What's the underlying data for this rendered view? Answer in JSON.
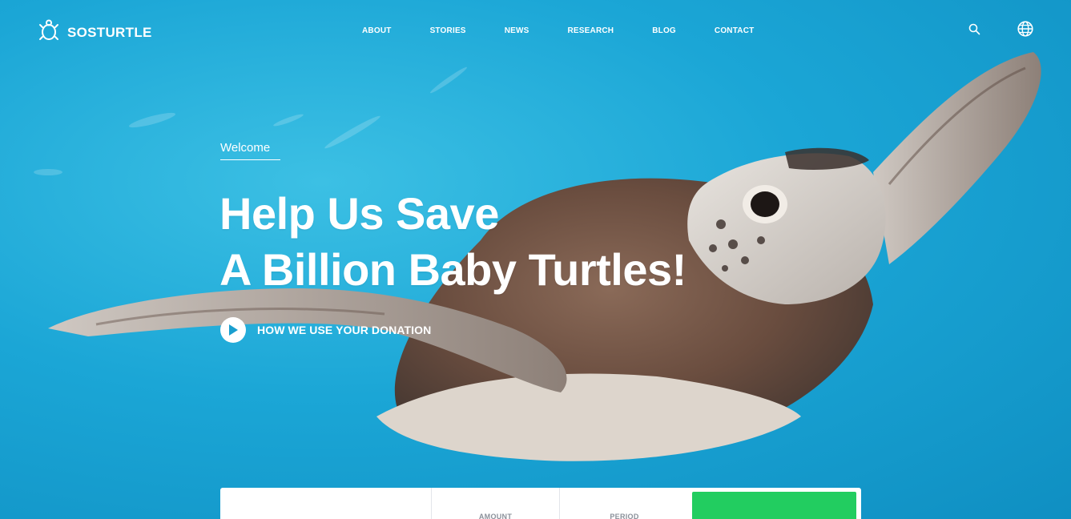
{
  "brand": {
    "name": "SOSTURTLE",
    "logo_icon": "turtle-icon"
  },
  "nav": {
    "items": [
      {
        "label": "ABOUT"
      },
      {
        "label": "STORIES"
      },
      {
        "label": "NEWS"
      },
      {
        "label": "RESEARCH"
      },
      {
        "label": "BLOG"
      },
      {
        "label": "CONTACT"
      }
    ],
    "search_icon": "search-icon",
    "language_icon": "globe-icon"
  },
  "hero": {
    "eyebrow": "Welcome",
    "headline_line1": "Help Us Save",
    "headline_line2": "A Billion Baby Turtles!",
    "video_link_label": "HOW WE USE YOUR DONATION",
    "video_icon": "play-icon",
    "background": "sea-turtle-photo"
  },
  "donation_form": {
    "amount_label": "AMOUNT",
    "period_label": "PERIOD",
    "submit_color": "#22cd60"
  },
  "colors": {
    "ocean": "#1ba6d6",
    "accent_green": "#22cd60",
    "text": "#ffffff"
  }
}
